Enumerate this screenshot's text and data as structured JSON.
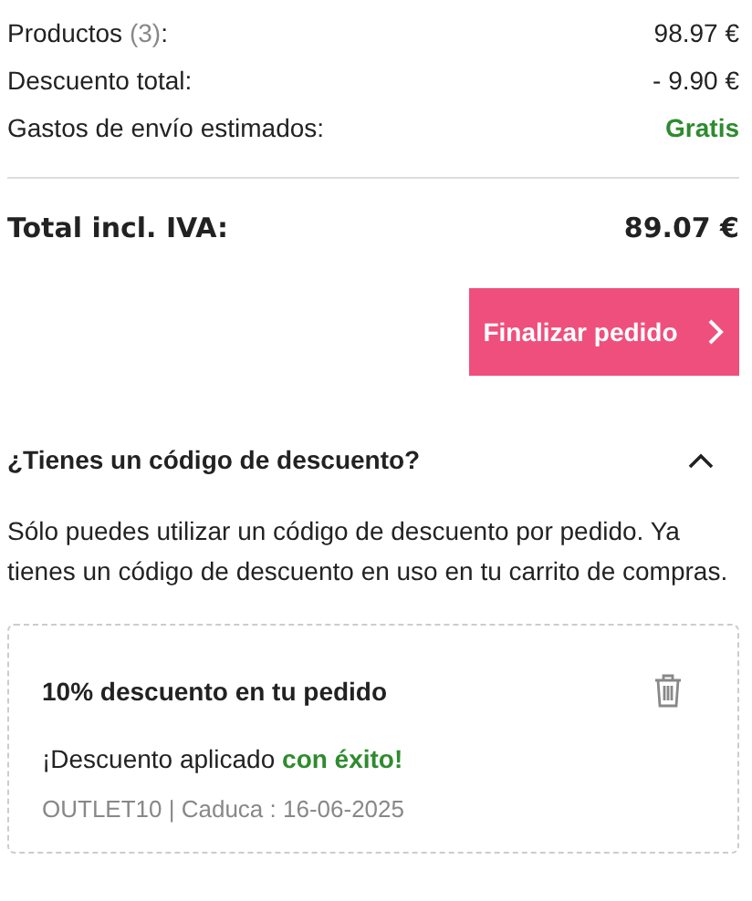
{
  "summary": [
    {
      "label": "Productos",
      "count": "(3)",
      "suffix": ":",
      "value": "98.97 €",
      "kind": "normal"
    },
    {
      "label": "Descuento total:",
      "value": "- 9.90 €",
      "kind": "normal"
    },
    {
      "label": "Gastos de envío estimados:",
      "value": "Gratis",
      "kind": "free"
    }
  ],
  "total": {
    "label": "Total incl. IVA:",
    "value": "89.07 €"
  },
  "checkout_button": {
    "label": "Finalizar pedido"
  },
  "discount": {
    "title": "¿Tienes un código de descuento?",
    "expanded": true,
    "note": "Sólo puedes utilizar un código de descuento por pedido. Ya tienes un código de descuento en uso en tu carrito de compras.",
    "coupon": {
      "title": "10% descuento en tu pedido",
      "message": "¡Descuento aplicado **con éxito!**",
      "meta": "OUTLET10 | Caduca : 16-06-2025"
    }
  }
}
